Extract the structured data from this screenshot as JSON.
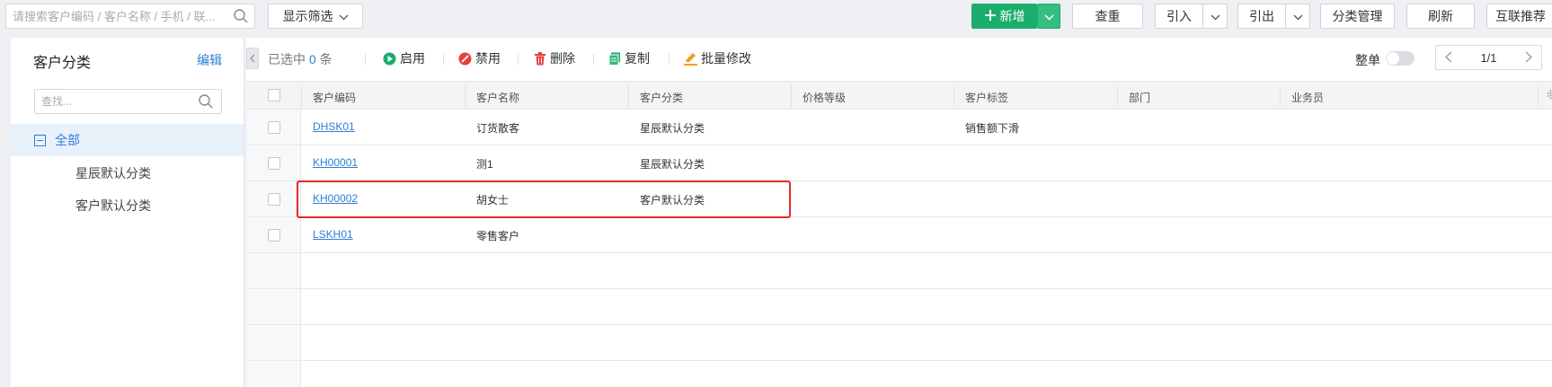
{
  "toolbar": {
    "search_placeholder": "请搜索客户编码 / 客户名称 / 手机 / 联...",
    "filter_label": "显示筛选",
    "new_label": "新增",
    "dedupe_label": "查重",
    "import_label": "引入",
    "export_label": "引出",
    "category_manage_label": "分类管理",
    "refresh_label": "刷新",
    "recommend_label": "互联推荐"
  },
  "sidebar": {
    "title": "客户分类",
    "edit_label": "编辑",
    "search_placeholder": "查找...",
    "root_label": "全部",
    "items": [
      {
        "label": "星辰默认分类"
      },
      {
        "label": "客户默认分类"
      }
    ]
  },
  "actions": {
    "selected_prefix": "已选中",
    "selected_count": "0",
    "selected_suffix": "条",
    "enable_label": "启用",
    "disable_label": "禁用",
    "delete_label": "删除",
    "copy_label": "复制",
    "batch_edit_label": "批量修改",
    "whole_unit_label": "整单",
    "page_indicator": "1/1"
  },
  "table": {
    "columns": [
      "客户编码",
      "客户名称",
      "客户分类",
      "价格等级",
      "客户标签",
      "部门",
      "业务员"
    ],
    "rows": [
      {
        "code": "DHSK01",
        "name": "订货散客",
        "category": "星辰默认分类",
        "price_level": "",
        "tag": "销售额下滑",
        "dept": "",
        "salesman": ""
      },
      {
        "code": "KH00001",
        "name": "测1",
        "category": "星辰默认分类",
        "price_level": "",
        "tag": "",
        "dept": "",
        "salesman": ""
      },
      {
        "code": "KH00002",
        "name": "胡女士",
        "category": "客户默认分类",
        "price_level": "",
        "tag": "",
        "dept": "",
        "salesman": ""
      },
      {
        "code": "LSKH01",
        "name": "零售客户",
        "category": "",
        "price_level": "",
        "tag": "",
        "dept": "",
        "salesman": ""
      }
    ]
  },
  "colors": {
    "accent": "#2e7fd6",
    "primary_green": "#1aad6e",
    "highlight_red": "#e52a26"
  }
}
